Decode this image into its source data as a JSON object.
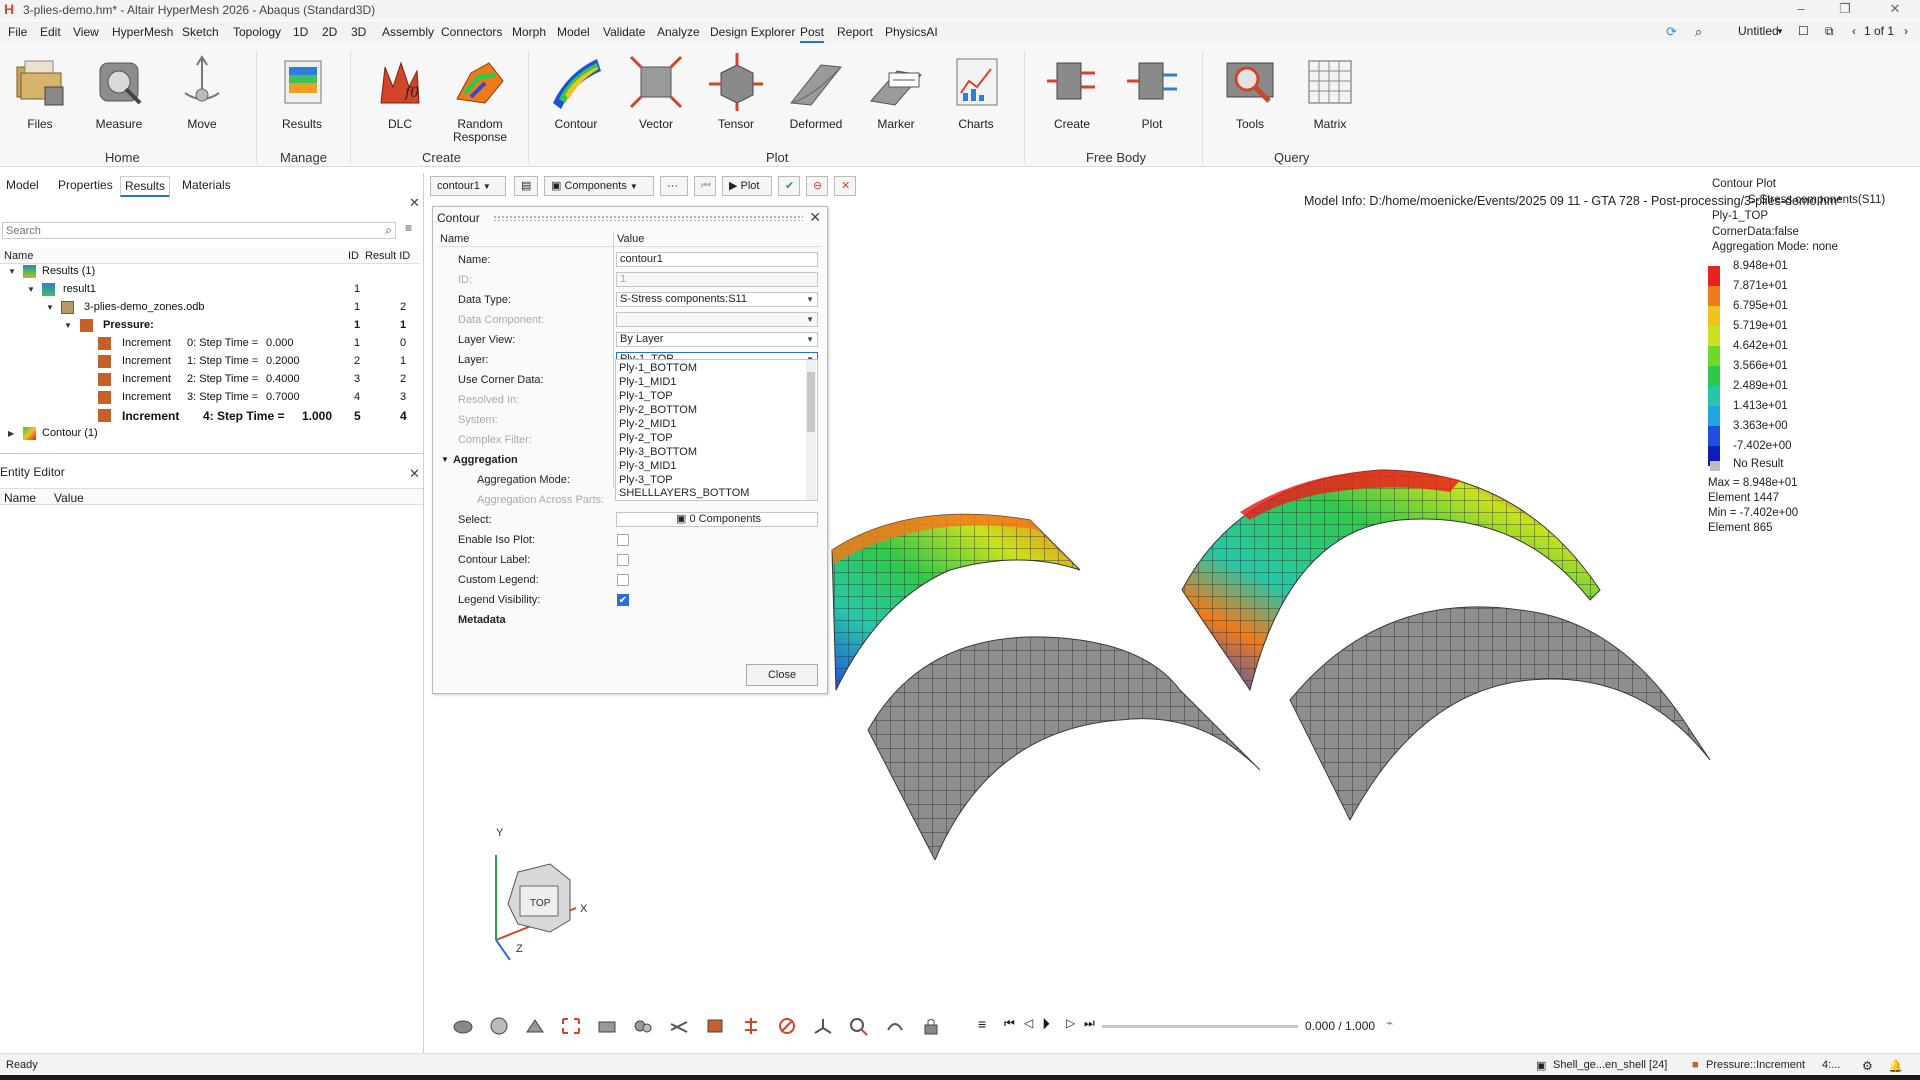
{
  "window": {
    "title": "3-plies-demo.hm* - Altair HyperMesh 2026 - Abaqus (Standard3D)",
    "logo_letter": "H",
    "controls": [
      "–",
      "❐",
      "✕"
    ]
  },
  "menu": {
    "items": [
      "File",
      "Edit",
      "View",
      "HyperMesh",
      "Sketch",
      "Topology",
      "1D",
      "2D",
      "3D",
      "Assembly",
      "Connectors",
      "Morph",
      "Model",
      "Validate",
      "Analyze",
      "Design Explorer",
      "Post",
      "Report",
      "PhysicsAI"
    ],
    "active": "Post",
    "right_untitled": "Untitled",
    "page_indicator": "1 of 1"
  },
  "ribbon": {
    "tools": [
      {
        "label": "Files",
        "icon": "files-icon"
      },
      {
        "label": "Measure",
        "icon": "measure-icon"
      },
      {
        "label": "Move",
        "icon": "move-icon"
      },
      {
        "label": "Results",
        "icon": "results-icon"
      },
      {
        "label": "DLC",
        "icon": "dlc-icon"
      },
      {
        "label": "Random Response",
        "icon": "random-response-icon"
      },
      {
        "label": "Contour",
        "icon": "contour-icon"
      },
      {
        "label": "Vector",
        "icon": "vector-icon"
      },
      {
        "label": "Tensor",
        "icon": "tensor-icon"
      },
      {
        "label": "Deformed",
        "icon": "deformed-icon"
      },
      {
        "label": "Marker",
        "icon": "marker-icon"
      },
      {
        "label": "Charts",
        "icon": "charts-icon"
      },
      {
        "label": "Create",
        "icon": "create-icon"
      },
      {
        "label": "Plot",
        "icon": "plot-icon"
      },
      {
        "label": "Tools",
        "icon": "tools-icon"
      },
      {
        "label": "Matrix",
        "icon": "matrix-icon"
      }
    ],
    "groups": [
      "Home",
      "Manage",
      "Create",
      "Plot",
      "Free Body",
      "Query"
    ]
  },
  "left_panel": {
    "tabs": [
      "Model",
      "Properties",
      "Results",
      "Materials"
    ],
    "active_tab": "Results",
    "search_placeholder": "Search",
    "columns": {
      "name": "Name",
      "id": "ID",
      "result_id": "Result ID"
    },
    "tree": [
      {
        "label": "Results (1)",
        "id": "",
        "rid": ""
      },
      {
        "label": "result1",
        "id": "1",
        "rid": ""
      },
      {
        "label": "3-plies-demo_zones.odb",
        "id": "1",
        "rid": "2"
      },
      {
        "label": "Pressure:",
        "id": "1",
        "rid": "1"
      },
      {
        "label": "Increment",
        "step": "0: Step Time =",
        "time": "0.000",
        "id": "1",
        "rid": "0"
      },
      {
        "label": "Increment",
        "step": "1: Step Time =",
        "time": "0.2000",
        "id": "2",
        "rid": "1"
      },
      {
        "label": "Increment",
        "step": "2: Step Time =",
        "time": "0.4000",
        "id": "3",
        "rid": "2"
      },
      {
        "label": "Increment",
        "step": "3: Step Time =",
        "time": "0.7000",
        "id": "4",
        "rid": "3"
      },
      {
        "label": "Increment",
        "step": "4: Step Time =",
        "time": "1.000",
        "id": "5",
        "rid": "4"
      },
      {
        "label": "Contour (1)",
        "id": "",
        "rid": ""
      }
    ],
    "entity_editor": {
      "title": "Entity Editor",
      "col_name": "Name",
      "col_value": "Value"
    }
  },
  "viewport_toolbar": {
    "contour_select": "contour1",
    "components": "Components",
    "more": "···",
    "plot": "Plot"
  },
  "contour_dialog": {
    "title": "Contour",
    "col_name": "Name",
    "col_value": "Value",
    "rows": {
      "name": {
        "label": "Name:",
        "value": "contour1"
      },
      "id": {
        "label": "ID:",
        "value": "1"
      },
      "data_type": {
        "label": "Data Type:",
        "value": "S-Stress components:S11"
      },
      "data_component": {
        "label": "Data Component:",
        "value": ""
      },
      "layer_view": {
        "label": "Layer View:",
        "value": "By Layer"
      },
      "layer": {
        "label": "Layer:",
        "value": "Ply-1_TOP"
      },
      "use_corner_data": {
        "label": "Use Corner Data:"
      },
      "resolved_in": {
        "label": "Resolved In:"
      },
      "system": {
        "label": "System:"
      },
      "complex_filter": {
        "label": "Complex Filter:"
      },
      "aggregation": {
        "label": "Aggregation"
      },
      "aggregation_mode": {
        "label": "Aggregation Mode:"
      },
      "aggregation_across_parts": {
        "label": "Aggregation Across Parts:"
      },
      "select": {
        "label": "Select:",
        "value": "0 Components"
      },
      "enable_iso_plot": {
        "label": "Enable Iso Plot:"
      },
      "contour_label": {
        "label": "Contour Label:"
      },
      "custom_legend": {
        "label": "Custom Legend:"
      },
      "legend_visibility": {
        "label": "Legend Visibility:"
      },
      "metadata": {
        "label": "Metadata"
      }
    },
    "layer_options": [
      "Ply-1_BOTTOM",
      "Ply-1_MID1",
      "Ply-1_TOP",
      "Ply-2_BOTTOM",
      "Ply-2_MID1",
      "Ply-2_TOP",
      "Ply-3_BOTTOM",
      "Ply-3_MID1",
      "Ply-3_TOP",
      "SHELLLAYERS_BOTTOM"
    ],
    "close": "Close"
  },
  "model_info": "Model Info: D:/home/moenicke/Events/2025 09 11 - GTA 728 - Post-processing/3-plies-demo.hm*",
  "legend": {
    "title": "Contour Plot",
    "subtitle": "S-Stress components(S11)",
    "layer": "Ply-1_TOP",
    "corner": "CornerData:false",
    "aggregation": "Aggregation Mode: none",
    "values": [
      "8.948e+01",
      "7.871e+01",
      "6.795e+01",
      "5.719e+01",
      "4.642e+01",
      "3.566e+01",
      "2.489e+01",
      "1.413e+01",
      "3.363e+00",
      "-7.402e+00"
    ],
    "colors": [
      "#e8221c",
      "#f27a1a",
      "#f2c21c",
      "#c9e21d",
      "#6fd92a",
      "#2ec94a",
      "#25c7a8",
      "#1fa6e0",
      "#1f4fe0",
      "#0a1fb8"
    ],
    "no_result": "No Result",
    "max": "Max = 8.948e+01",
    "max_elem": "Element 1447",
    "min": "Min = -7.402e+00",
    "min_elem": "Element 865"
  },
  "triad": {
    "y": "Y",
    "x": "X",
    "z": "Z",
    "face": "TOP"
  },
  "animation": {
    "value": "0.000 / 1.000"
  },
  "status": {
    "left": "Ready",
    "component": "Shell_ge...en_shell [24]",
    "result": "Pressure::Increment",
    "step": "4:..."
  }
}
